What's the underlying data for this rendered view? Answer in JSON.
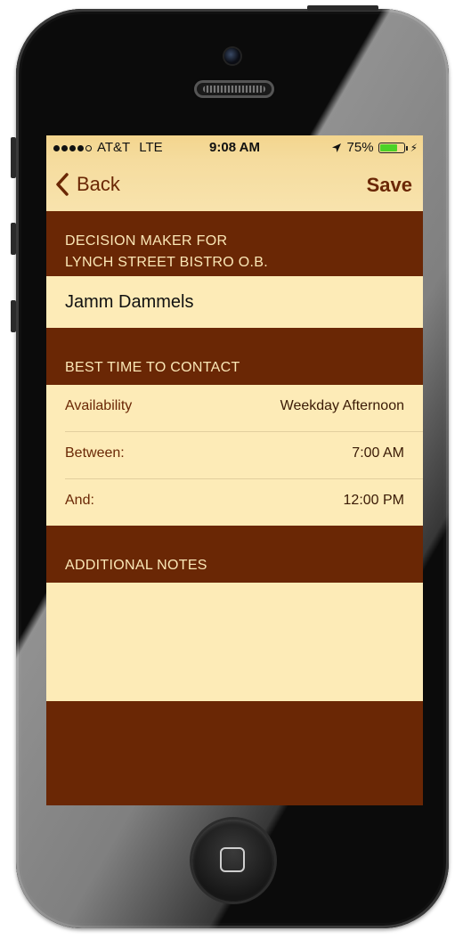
{
  "status_bar": {
    "signal_dots": 5,
    "signal_filled": 4,
    "carrier": "AT&T",
    "network": "LTE",
    "time": "9:08 AM",
    "battery_percent": "75%",
    "battery_level": 0.75,
    "icons": [
      "location-arrow-icon",
      "battery-icon",
      "charging-bolt-icon"
    ]
  },
  "nav": {
    "back_label": "Back",
    "save_label": "Save"
  },
  "sections": {
    "decision_maker": {
      "header_line1": "DECISION MAKER FOR",
      "header_line2": "LYNCH STREET BISTRO O.B.",
      "name": "Jamm Dammels"
    },
    "best_time": {
      "header": "BEST TIME TO CONTACT",
      "rows": [
        {
          "label": "Availability",
          "value": "Weekday Afternoon"
        },
        {
          "label": "Between:",
          "value": "7:00 AM"
        },
        {
          "label": "And:",
          "value": "12:00 PM"
        }
      ]
    },
    "notes": {
      "header": "ADDITIONAL NOTES",
      "value": ""
    }
  },
  "colors": {
    "header_brown": "#6a2705",
    "cell_cream": "#fdebb7",
    "nav_gold": "#f5dc9e",
    "battery_green": "#4cd227"
  }
}
